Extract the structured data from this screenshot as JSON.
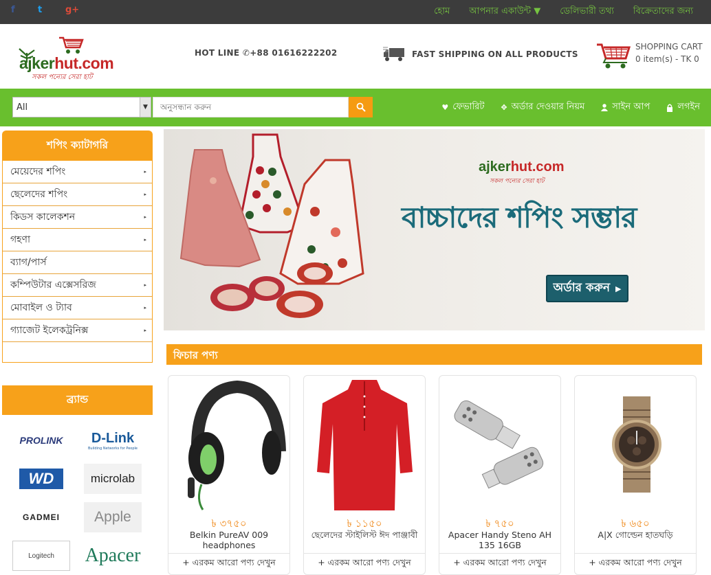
{
  "topbar": {
    "social": {
      "facebook": "f",
      "twitter": "t",
      "googleplus": "g+"
    },
    "nav": [
      "হোম",
      "আপনার একাউন্ট ▼",
      "ডেলিভারী তথ্য",
      "বিক্রেতাদের জন্য"
    ]
  },
  "header": {
    "logo": {
      "part1": "ajker",
      "part2": "hut.com",
      "tagline": "সকল পন্যের সেরা হাট"
    },
    "hotline": "HOT LINE ✆+88 01616222202",
    "shipping": "FAST SHIPPING ON ALL PRODUCTS",
    "cart": {
      "title": "SHOPPING CART",
      "summary": "0 item(s) - TK 0"
    }
  },
  "searchbar": {
    "category_selected": "All",
    "placeholder": "অনুসন্ধান করুন",
    "nav": [
      {
        "icon": "heart-icon",
        "label": "ফেভারিট"
      },
      {
        "icon": "move-icon",
        "label": "অর্ডার দেওয়ার নিয়ম"
      },
      {
        "icon": "user-icon",
        "label": "সাইন আপ"
      },
      {
        "icon": "lock-icon",
        "label": "লগইন"
      }
    ]
  },
  "sidebar": {
    "title": "শপিং ক্যাটাগরি",
    "items": [
      {
        "label": "মেয়েদের শপিং",
        "caret": "▸"
      },
      {
        "label": "ছেলেদের শপিং",
        "caret": "▸"
      },
      {
        "label": "কিডস কালেকশন",
        "caret": "▸"
      },
      {
        "label": "গহণা",
        "caret": "▸"
      },
      {
        "label": "ব্যাগ/পার্স",
        "caret": ""
      },
      {
        "label": "কম্পিউটার এক্সেসরিজ",
        "caret": "▸"
      },
      {
        "label": "মোবাইল ও ট্যাব",
        "caret": "▸"
      },
      {
        "label": "গ্যাজেট ইলেকট্রনিক্স",
        "caret": "▸"
      }
    ],
    "brands_title": "ব্র্যান্ড",
    "brands": [
      "PROLINK",
      "D-Link",
      "WD",
      "microlab",
      "GADMEI",
      "Apple",
      "Logitech",
      "Apacer"
    ],
    "dlink_tagline": "Building Networks for People"
  },
  "banner": {
    "logo_part1": "ajker",
    "logo_part2": "hut.com",
    "logo_tagline": "সকল পন্যের সেরা হাট",
    "title": "বাচ্চাদের শপিং সম্ভার",
    "button": "অর্ডার করুন"
  },
  "featured": {
    "title": "ফিচার পণ্য",
    "more_label": "+ এরকম আরো পণ্য দেখুন",
    "products": [
      {
        "price": "৳ ৩৭৫০",
        "name": "Belkin PureAV 009 headphones"
      },
      {
        "price": "৳ ১১৫০",
        "name": "ছেলেদের স্টাইলিস্ট ঈদ পাঞ্জাবী"
      },
      {
        "price": "৳ ৭৫০",
        "name": "Apacer Handy Steno AH 135 16GB"
      },
      {
        "price": "৳ ৬৫০",
        "name": "A|X গোল্ডেন হাতঘড়ি"
      }
    ]
  },
  "colors": {
    "green": "#69bf2e",
    "orange": "#f7a11a",
    "dark": "#3c3c3c"
  }
}
